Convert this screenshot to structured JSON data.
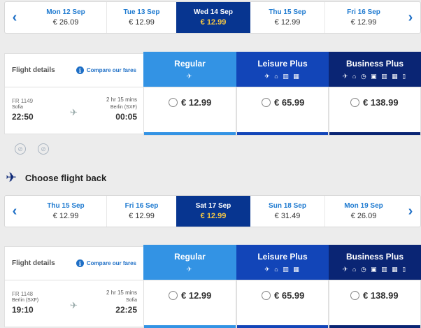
{
  "outbound": {
    "dates": [
      {
        "day": "Mon 12 Sep",
        "price": "€ 26.09",
        "selected": false
      },
      {
        "day": "Tue 13 Sep",
        "price": "€ 12.99",
        "selected": false
      },
      {
        "day": "Wed 14 Sep",
        "price": "€ 12.99",
        "selected": true
      },
      {
        "day": "Thu 15 Sep",
        "price": "€ 12.99",
        "selected": false
      },
      {
        "day": "Fri 16 Sep",
        "price": "€ 12.99",
        "selected": false
      }
    ],
    "flight_details_label": "Flight details",
    "compare_label": "Compare our fares",
    "fares": [
      {
        "name": "Regular",
        "icons": "✈",
        "price": "€ 12.99"
      },
      {
        "name": "Leisure Plus",
        "icons": "✈ ⌂ ▥ ▦",
        "price": "€ 65.99"
      },
      {
        "name": "Business Plus",
        "icons": "✈ ⌂ ◷ ▣ ▥ ▦ ▯",
        "price": "€ 138.99"
      }
    ],
    "flight": {
      "number": "FR 1149",
      "duration": "2 hr 15 mins",
      "origin": "Sofia",
      "destination": "Berlin (SXF)",
      "depart": "22:50",
      "arrive": "00:05"
    }
  },
  "back_heading": "Choose flight back",
  "inbound": {
    "dates": [
      {
        "day": "Thu 15 Sep",
        "price": "€ 12.99",
        "selected": false
      },
      {
        "day": "Fri 16 Sep",
        "price": "€ 12.99",
        "selected": false
      },
      {
        "day": "Sat 17 Sep",
        "price": "€ 12.99",
        "selected": true
      },
      {
        "day": "Sun 18 Sep",
        "price": "€ 31.49",
        "selected": false
      },
      {
        "day": "Mon 19 Sep",
        "price": "€ 26.09",
        "selected": false
      }
    ],
    "flight_details_label": "Flight details",
    "compare_label": "Compare our fares",
    "fares": [
      {
        "name": "Regular",
        "icons": "✈",
        "price": "€ 12.99"
      },
      {
        "name": "Leisure Plus",
        "icons": "✈ ⌂ ▥ ▦",
        "price": "€ 65.99"
      },
      {
        "name": "Business Plus",
        "icons": "✈ ⌂ ◷ ▣ ▥ ▦ ▯",
        "price": "€ 138.99"
      }
    ],
    "flight": {
      "number": "FR 1148",
      "duration": "2 hr 15 mins",
      "origin": "Berlin (SXF)",
      "destination": "Sofia",
      "depart": "19:10",
      "arrive": "22:25"
    }
  },
  "colors": {
    "accent": "#1e6fc6",
    "selected_bg": "#073590",
    "selected_price": "#f6c844",
    "regular": "#3393e4",
    "leisure": "#1245b8",
    "business": "#0a2574"
  }
}
